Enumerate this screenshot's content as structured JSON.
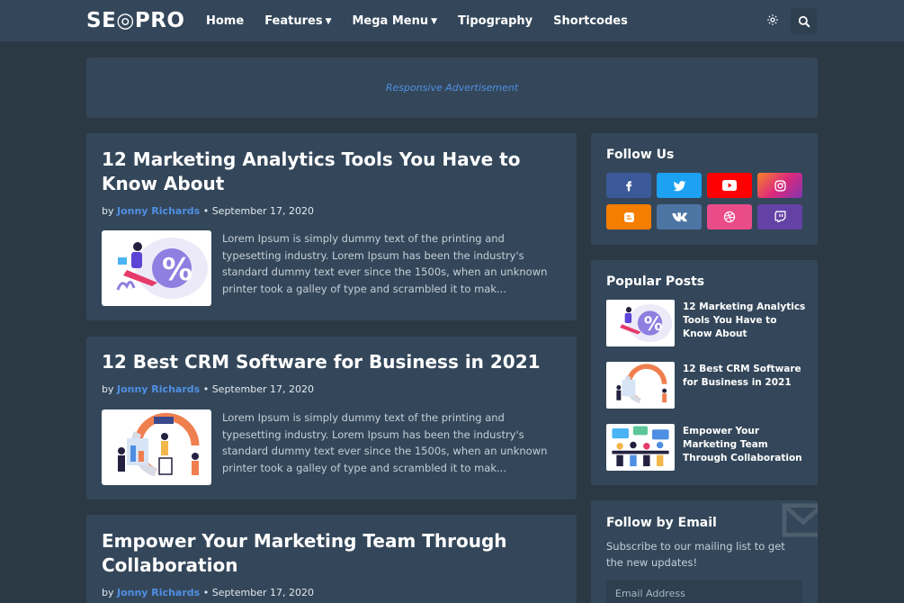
{
  "header": {
    "logo": "SE◎PRO",
    "nav": [
      {
        "label": "Home",
        "dropdown": false
      },
      {
        "label": "Features",
        "dropdown": true
      },
      {
        "label": "Mega Menu",
        "dropdown": true
      },
      {
        "label": "Tipography",
        "dropdown": false
      },
      {
        "label": "Shortcodes",
        "dropdown": false
      }
    ],
    "icons": [
      "gear-icon",
      "search-icon"
    ]
  },
  "ad": {
    "text": "Responsive Advertisement"
  },
  "posts": [
    {
      "title": "12 Marketing Analytics Tools You Have to Know About",
      "by": "by",
      "author": "Jonny Richards",
      "date": "September 17, 2020",
      "excerpt": "Lorem Ipsum is simply dummy text of the printing and typesetting industry. Lorem Ipsum has been the industry's standard dummy text ever since the 1500s, when an unknown printer took a galley of type and scrambled it to mak..."
    },
    {
      "title": "12 Best CRM Software for Business in 2021",
      "by": "by",
      "author": "Jonny Richards",
      "date": "September 17, 2020",
      "excerpt": "Lorem Ipsum is simply dummy text of the printing and typesetting industry. Lorem Ipsum has been the industry's standard dummy text ever since the 1500s, when an unknown printer took a galley of type and scrambled it to mak..."
    },
    {
      "title": "Empower Your Marketing Team Through Collaboration",
      "by": "by",
      "author": "Jonny Richards",
      "date": "September 17, 2020"
    }
  ],
  "sidebar": {
    "follow": {
      "title": "Follow Us",
      "networks": [
        {
          "name": "facebook-icon",
          "color": "#3b5998"
        },
        {
          "name": "twitter-icon",
          "color": "#1da1f2"
        },
        {
          "name": "youtube-icon",
          "color": "#ff0000"
        },
        {
          "name": "instagram-icon",
          "color": "#e1306c"
        },
        {
          "name": "blogger-icon",
          "color": "#f57d00"
        },
        {
          "name": "vk-icon",
          "color": "#4c75a3"
        },
        {
          "name": "dribbble-icon",
          "color": "#ea4c89"
        },
        {
          "name": "twitch-icon",
          "color": "#6441a5"
        }
      ]
    },
    "popular": {
      "title": "Popular Posts",
      "items": [
        {
          "title": "12 Marketing Analytics Tools You Have to Know About"
        },
        {
          "title": "12 Best CRM Software for Business in 2021"
        },
        {
          "title": "Empower Your Marketing Team Through Collaboration"
        }
      ]
    },
    "email": {
      "title": "Follow by Email",
      "description": "Subscribe to our mailing list to get the new updates!",
      "placeholder": "Email Address"
    }
  },
  "colors": {
    "accent": "#4f8fe3",
    "background": "#2b3945",
    "card": "#34475a"
  }
}
